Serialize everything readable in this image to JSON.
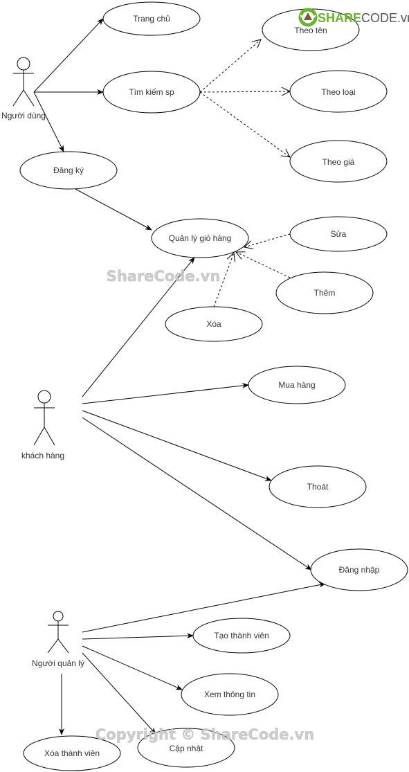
{
  "diagram": {
    "type": "use-case",
    "actors": [
      {
        "id": "a1",
        "label": "Người dùng"
      },
      {
        "id": "a2",
        "label": "khách hàng"
      },
      {
        "id": "a3",
        "label": "Người quản lý"
      }
    ],
    "use_cases": [
      {
        "id": "trang_chu",
        "label": "Trang chủ"
      },
      {
        "id": "tim_kiem",
        "label": "Tìm kiếm sp"
      },
      {
        "id": "theo_ten",
        "label": "Theo tên"
      },
      {
        "id": "theo_loai",
        "label": "Theo loại"
      },
      {
        "id": "theo_gia",
        "label": "Theo giá"
      },
      {
        "id": "dang_ky",
        "label": "Đăng ký"
      },
      {
        "id": "ql_gio_hang",
        "label": "Quản lý giỏ hàng"
      },
      {
        "id": "sua",
        "label": "Sửa"
      },
      {
        "id": "them",
        "label": "Thêm"
      },
      {
        "id": "xoa",
        "label": "Xóa"
      },
      {
        "id": "mua_hang",
        "label": "Mua hàng"
      },
      {
        "id": "thoat",
        "label": "Thoát"
      },
      {
        "id": "dang_nhap",
        "label": "Đăng nhập"
      },
      {
        "id": "tao_tv",
        "label": "Tạo thành viên"
      },
      {
        "id": "xem_tt",
        "label": "Xem thông tin"
      },
      {
        "id": "xoa_tv",
        "label": "Xóa thành viên"
      },
      {
        "id": "cap_nhat",
        "label": "Cập nhật"
      }
    ],
    "associations": [
      {
        "from": "a1",
        "to": "trang_chu",
        "style": "solid"
      },
      {
        "from": "a1",
        "to": "tim_kiem",
        "style": "solid"
      },
      {
        "from": "a1",
        "to": "dang_ky",
        "style": "solid"
      },
      {
        "from": "dang_ky",
        "to": "ql_gio_hang",
        "style": "solid"
      },
      {
        "from": "tim_kiem",
        "to": "theo_ten",
        "style": "dashed"
      },
      {
        "from": "tim_kiem",
        "to": "theo_loai",
        "style": "dashed"
      },
      {
        "from": "tim_kiem",
        "to": "theo_gia",
        "style": "dashed"
      },
      {
        "from": "sua",
        "to": "ql_gio_hang",
        "style": "dashed"
      },
      {
        "from": "them",
        "to": "ql_gio_hang",
        "style": "dashed"
      },
      {
        "from": "xoa",
        "to": "ql_gio_hang",
        "style": "dashed"
      },
      {
        "from": "a2",
        "to": "ql_gio_hang",
        "style": "solid"
      },
      {
        "from": "a2",
        "to": "mua_hang",
        "style": "solid"
      },
      {
        "from": "a2",
        "to": "thoat",
        "style": "solid"
      },
      {
        "from": "a2",
        "to": "dang_nhap",
        "style": "solid"
      },
      {
        "from": "a3",
        "to": "dang_nhap",
        "style": "solid"
      },
      {
        "from": "a3",
        "to": "tao_tv",
        "style": "solid"
      },
      {
        "from": "a3",
        "to": "xem_tt",
        "style": "solid"
      },
      {
        "from": "a3",
        "to": "cap_nhat",
        "style": "solid"
      },
      {
        "from": "a3",
        "to": "xoa_tv",
        "style": "solid"
      }
    ]
  },
  "watermarks": {
    "logo_share": "SHARE",
    "logo_code": "CODE.vn",
    "mid": "ShareCode.vn",
    "bottom": "Copyright © ShareCode.vn"
  },
  "colors": {
    "stroke": "#000000",
    "text": "#333333",
    "logo_green": "#6ab42d",
    "logo_brown": "#7a5a3a",
    "watermark": "#c8c8c8"
  }
}
